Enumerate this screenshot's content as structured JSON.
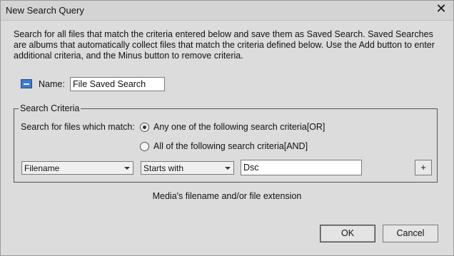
{
  "window": {
    "title": "New Search Query",
    "close_icon": "close-icon"
  },
  "description": "Search for all files that match the criteria entered below and save them as Saved Search. Saved Searches are albums that automatically collect files that match the criteria defined below. Use the Add button to enter additional criteria, and the Minus button to remove criteria.",
  "name": {
    "label": "Name:",
    "value": "File Saved Search",
    "icon": "saved-search-icon"
  },
  "criteria": {
    "legend": "Search Criteria",
    "match_label": "Search for files which match:",
    "options": [
      {
        "label": "Any one of the following search criteria[OR]",
        "checked": true
      },
      {
        "label": "All of the following search criteria[AND]",
        "checked": false
      }
    ],
    "rule": {
      "field": "Filename",
      "operator": "Starts with",
      "value": "Dsc"
    },
    "add_button": "+"
  },
  "hint": "Media's filename and/or file extension",
  "buttons": {
    "ok": "OK",
    "cancel": "Cancel"
  }
}
